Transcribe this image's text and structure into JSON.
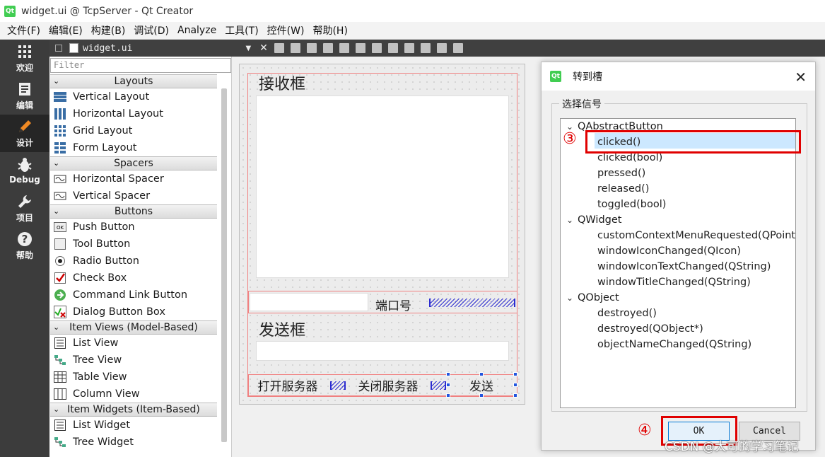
{
  "window": {
    "title": "widget.ui @ TcpServer - Qt Creator",
    "logo": "Qt"
  },
  "menu": [
    "文件(F)",
    "编辑(E)",
    "构建(B)",
    "调试(D)",
    "Analyze",
    "工具(T)",
    "控件(W)",
    "帮助(H)"
  ],
  "modes": [
    {
      "label": "欢迎",
      "icon": "grid-icon"
    },
    {
      "label": "编辑",
      "icon": "document-icon"
    },
    {
      "label": "设计",
      "icon": "pencil-icon"
    },
    {
      "label": "Debug",
      "icon": "bug-icon"
    },
    {
      "label": "项目",
      "icon": "wrench-icon"
    },
    {
      "label": "帮助",
      "icon": "help-icon"
    }
  ],
  "editor": {
    "file": "widget.ui"
  },
  "widget_box": {
    "filter_placeholder": "Filter",
    "categories": [
      {
        "name": "Layouts",
        "items": [
          "Vertical Layout",
          "Horizontal Layout",
          "Grid Layout",
          "Form Layout"
        ]
      },
      {
        "name": "Spacers",
        "items": [
          "Horizontal Spacer",
          "Vertical Spacer"
        ]
      },
      {
        "name": "Buttons",
        "items": [
          "Push Button",
          "Tool Button",
          "Radio Button",
          "Check Box",
          "Command Link Button",
          "Dialog Button Box"
        ]
      },
      {
        "name": "Item Views (Model-Based)",
        "items": [
          "List View",
          "Tree View",
          "Table View",
          "Column View"
        ]
      },
      {
        "name": "Item Widgets (Item-Based)",
        "items": [
          "List Widget",
          "Tree Widget"
        ]
      }
    ]
  },
  "form": {
    "receive_label": "接收框",
    "port_label": "端口号",
    "send_label": "发送框",
    "open_button": "打开服务器",
    "close_button": "关闭服务器",
    "send_button": "发送"
  },
  "dialog": {
    "title": "转到槽",
    "group_label": "选择信号",
    "groups": [
      {
        "name": "QAbstractButton",
        "signals": [
          "clicked()",
          "clicked(bool)",
          "pressed()",
          "released()",
          "toggled(bool)"
        ]
      },
      {
        "name": "QWidget",
        "signals": [
          "customContextMenuRequested(QPoint)",
          "windowIconChanged(QIcon)",
          "windowIconTextChanged(QString)",
          "windowTitleChanged(QString)"
        ]
      },
      {
        "name": "QObject",
        "signals": [
          "destroyed()",
          "destroyed(QObject*)",
          "objectNameChanged(QString)"
        ]
      }
    ],
    "selected_signal": "clicked()",
    "ok": "OK",
    "cancel": "Cancel"
  },
  "annotations": {
    "step3": "③",
    "step4": "④"
  },
  "watermark": "CSDN @大可的学习笔记",
  "colors": {
    "annotation": "#e00000",
    "selection": "#cce8ff",
    "accent": "#41cd52"
  }
}
